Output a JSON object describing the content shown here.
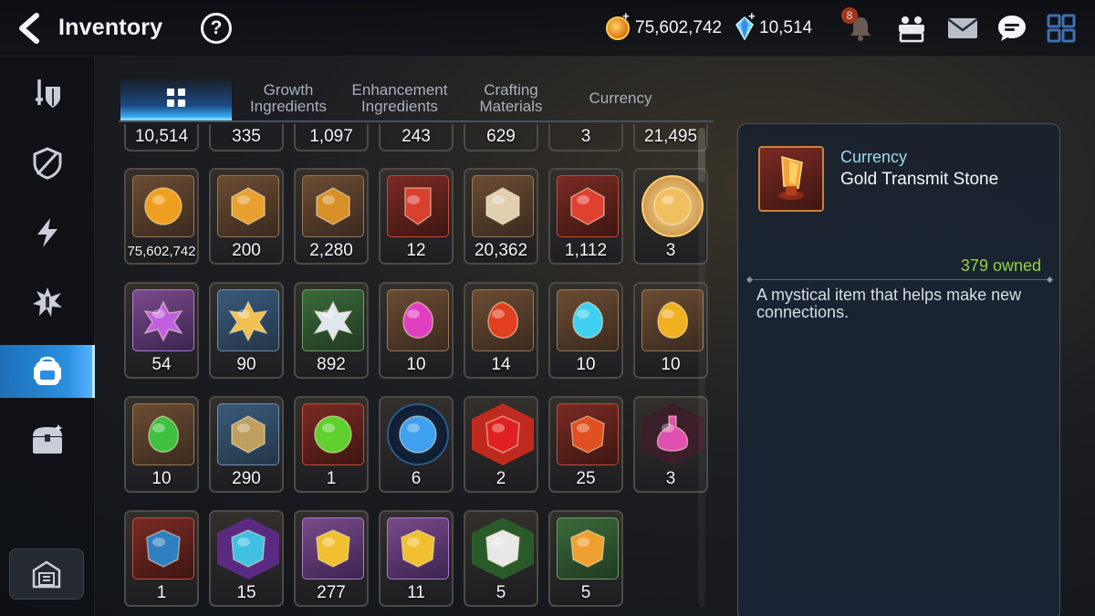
{
  "header": {
    "title": "Inventory",
    "help_label": "?",
    "gold": "75,602,742",
    "crystals": "10,514",
    "notification_count": "8",
    "gold_plus": "+",
    "gem_plus": "+"
  },
  "tabs": [
    {
      "label": "",
      "icon": "grid-icon",
      "active": true
    },
    {
      "label": "Growth\nIngredients"
    },
    {
      "label": "Enhancement\nIngredients"
    },
    {
      "label": "Crafting\nMaterials"
    },
    {
      "label": "Currency"
    }
  ],
  "tab_labels": {
    "growth_1": "Growth",
    "growth_2": "Ingredients",
    "enh_1": "Enhancement",
    "enh_2": "Ingredients",
    "craft_1": "Crafting",
    "craft_2": "Materials",
    "currency": "Currency"
  },
  "sidebar": {
    "items": [
      "equipment-icon",
      "artifact-icon",
      "lightning-icon",
      "catalyst-icon",
      "bag-icon",
      "chest-icon"
    ],
    "active_index": 4,
    "bottom": "storage-icon"
  },
  "partial_row_counts": [
    "10,514",
    "335",
    "1,097",
    "243",
    "629",
    "3",
    "21,495"
  ],
  "rows": [
    [
      "75,602,742",
      "200",
      "2,280",
      "12",
      "20,362",
      "1,112",
      "3"
    ],
    [
      "54",
      "90",
      "892",
      "10",
      "14",
      "10",
      "10"
    ],
    [
      "10",
      "290",
      "1",
      "6",
      "2",
      "25",
      "3"
    ],
    [
      "1",
      "15",
      "277",
      "11",
      "5",
      "5"
    ]
  ],
  "detail": {
    "category": "Currency",
    "name": "Gold Transmit Stone",
    "owned": "379 owned",
    "description": "A mystical item that helps make new connections."
  },
  "colors": {
    "accent_blue": "#2a8fe0",
    "owned_green": "#8fd445",
    "category_cyan": "#9fd7ee"
  }
}
